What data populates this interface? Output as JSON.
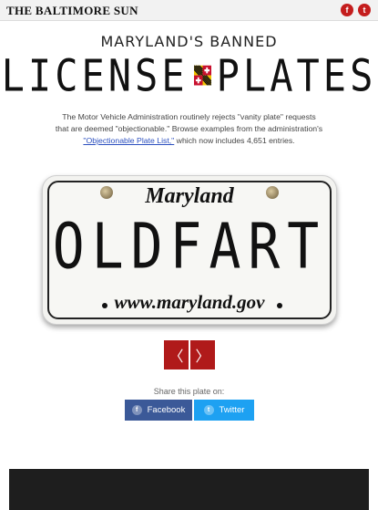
{
  "header": {
    "brand": "THE BALTIMORE SUN",
    "social": [
      {
        "icon": "facebook-icon",
        "glyph": "f"
      },
      {
        "icon": "twitter-icon",
        "glyph": "t"
      }
    ]
  },
  "hero": {
    "kicker": "MARYLAND'S BANNED",
    "title_left": "LICENSE",
    "title_right": "PLATES",
    "flag_icon": "maryland-flag-icon"
  },
  "intro": {
    "text_before": "The Motor Vehicle Administration routinely rejects \"vanity plate\" requests that are deemed \"objectionable.\" Browse examples from the administration's ",
    "link_text": "\"Objectionable Plate List,\"",
    "text_after": " which now includes 4,651 entries."
  },
  "plate": {
    "state": "Maryland",
    "text": "OLDFART",
    "url": "www.maryland.gov"
  },
  "nav": {
    "prev_icon": "chevron-left-icon",
    "next_icon": "chevron-right-icon",
    "prev_glyph": "〈",
    "next_glyph": "〉"
  },
  "share": {
    "label": "Share this plate on:",
    "facebook_label": "Facebook",
    "twitter_label": "Twitter",
    "facebook_glyph": "f",
    "twitter_glyph": "t"
  },
  "colors": {
    "accent_red": "#b01a1a",
    "facebook_blue": "#3b5998",
    "twitter_blue": "#1da1f2"
  }
}
